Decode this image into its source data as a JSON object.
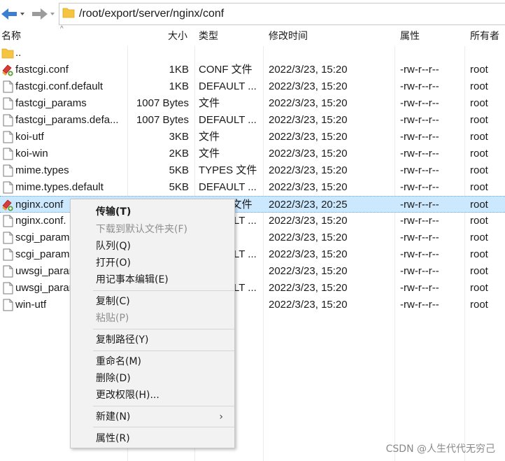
{
  "address": {
    "path": "/root/export/server/nginx/conf"
  },
  "columns": {
    "name": "名称",
    "size": "大小",
    "type": "类型",
    "modified": "修改时间",
    "permissions": "属性",
    "owner": "所有者"
  },
  "files": [
    {
      "name": "..",
      "size": "",
      "type": "",
      "modified": "",
      "permissions": "",
      "owner": "",
      "icon": "folder-icon"
    },
    {
      "name": "fastcgi.conf",
      "size": "1KB",
      "type": "CONF 文件",
      "modified": "2022/3/23, 15:20",
      "permissions": "-rw-r--r--",
      "owner": "root",
      "icon": "conf-file-icon"
    },
    {
      "name": "fastcgi.conf.default",
      "size": "1KB",
      "type": "DEFAULT ...",
      "modified": "2022/3/23, 15:20",
      "permissions": "-rw-r--r--",
      "owner": "root",
      "icon": "file-icon"
    },
    {
      "name": "fastcgi_params",
      "size": "1007 Bytes",
      "type": "文件",
      "modified": "2022/3/23, 15:20",
      "permissions": "-rw-r--r--",
      "owner": "root",
      "icon": "file-icon"
    },
    {
      "name": "fastcgi_params.defa...",
      "size": "1007 Bytes",
      "type": "DEFAULT ...",
      "modified": "2022/3/23, 15:20",
      "permissions": "-rw-r--r--",
      "owner": "root",
      "icon": "file-icon"
    },
    {
      "name": "koi-utf",
      "size": "3KB",
      "type": "文件",
      "modified": "2022/3/23, 15:20",
      "permissions": "-rw-r--r--",
      "owner": "root",
      "icon": "file-icon"
    },
    {
      "name": "koi-win",
      "size": "2KB",
      "type": "文件",
      "modified": "2022/3/23, 15:20",
      "permissions": "-rw-r--r--",
      "owner": "root",
      "icon": "file-icon"
    },
    {
      "name": "mime.types",
      "size": "5KB",
      "type": "TYPES 文件",
      "modified": "2022/3/23, 15:20",
      "permissions": "-rw-r--r--",
      "owner": "root",
      "icon": "file-icon"
    },
    {
      "name": "mime.types.default",
      "size": "5KB",
      "type": "DEFAULT ...",
      "modified": "2022/3/23, 15:20",
      "permissions": "-rw-r--r--",
      "owner": "root",
      "icon": "file-icon"
    },
    {
      "name": "nginx.conf",
      "size": "3KB",
      "type": "CONF 文件",
      "modified": "2022/3/23, 20:25",
      "permissions": "-rw-r--r--",
      "owner": "root",
      "icon": "conf-file-icon",
      "selected": true
    },
    {
      "name": "nginx.conf.",
      "size": "",
      "type": "DEFAULT ...",
      "modified": "2022/3/23, 15:20",
      "permissions": "-rw-r--r--",
      "owner": "root",
      "icon": "file-icon"
    },
    {
      "name": "scgi_params",
      "size": "",
      "type": "文件",
      "modified": "2022/3/23, 15:20",
      "permissions": "-rw-r--r--",
      "owner": "root",
      "icon": "file-icon"
    },
    {
      "name": "scgi_params",
      "size": "",
      "type": "DEFAULT ...",
      "modified": "2022/3/23, 15:20",
      "permissions": "-rw-r--r--",
      "owner": "root",
      "icon": "file-icon"
    },
    {
      "name": "uwsgi_params",
      "size": "",
      "type": "文件",
      "modified": "2022/3/23, 15:20",
      "permissions": "-rw-r--r--",
      "owner": "root",
      "icon": "file-icon"
    },
    {
      "name": "uwsgi_params",
      "size": "",
      "type": "DEFAULT ...",
      "modified": "2022/3/23, 15:20",
      "permissions": "-rw-r--r--",
      "owner": "root",
      "icon": "file-icon"
    },
    {
      "name": "win-utf",
      "size": "",
      "type": "文件",
      "modified": "2022/3/23, 15:20",
      "permissions": "-rw-r--r--",
      "owner": "root",
      "icon": "file-icon"
    }
  ],
  "context_menu": {
    "transfer": "传输(T)",
    "download_default": "下载到默认文件夹(F)",
    "queue": "队列(Q)",
    "open": "打开(O)",
    "edit_notepad": "用记事本编辑(E)",
    "copy": "复制(C)",
    "paste": "粘贴(P)",
    "copy_path": "复制路径(Y)",
    "rename": "重命名(M)",
    "delete": "删除(D)",
    "change_perms": "更改权限(H)...",
    "new": "新建(N)",
    "properties": "属性(R)"
  },
  "watermark": "CSDN @人生代代无穷己",
  "colors": {
    "selection": "#cce8ff",
    "menu_bg": "#f2f2f2",
    "nav_arrow": "#3c7fd1",
    "folder": "#f5c542"
  }
}
